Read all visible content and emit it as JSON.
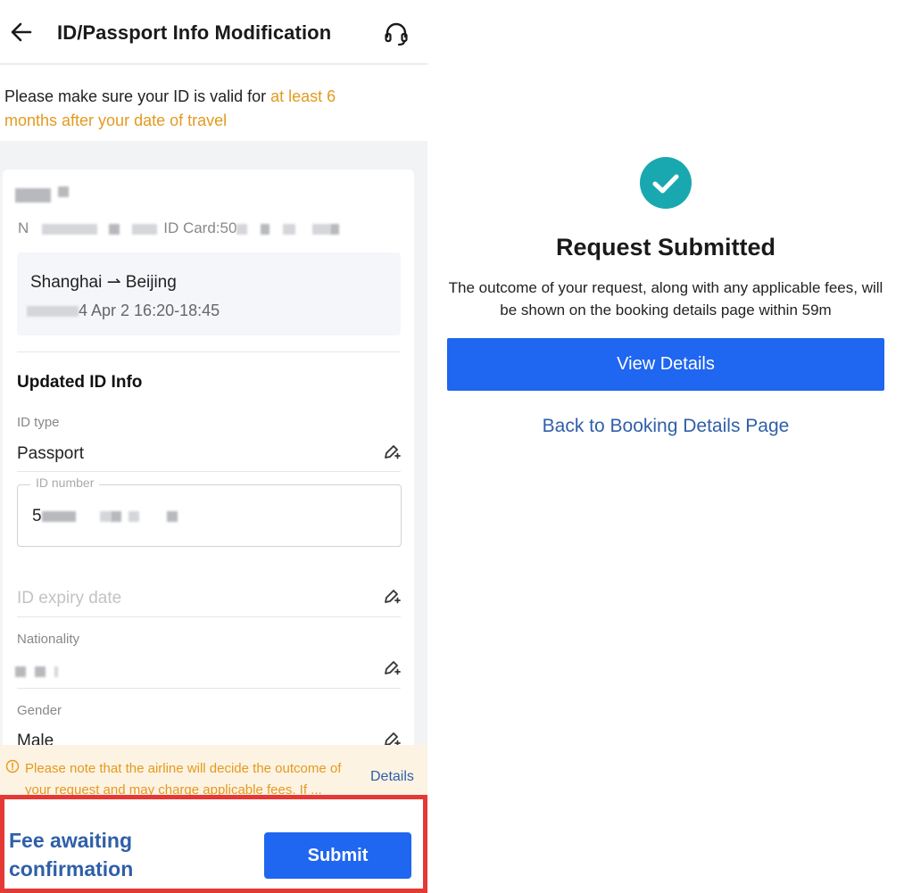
{
  "header": {
    "title": "ID/Passport Info Modification",
    "back_icon": "arrow-left-icon",
    "support_icon": "headset-icon"
  },
  "notice": {
    "prefix": "Please make sure your ID is valid for ",
    "highlight": "at least 6 months after your date of travel",
    "highlight_color": "#e39a1f"
  },
  "passenger": {
    "id_prefix": "N",
    "id_card_label": "ID Card:50"
  },
  "trip": {
    "route_from": "Shanghai",
    "route_arrow": "⇀",
    "route_to": "Beijing",
    "time_suffix": "4 Apr 2 16:20-18:45"
  },
  "updated_info": {
    "section_title": "Updated ID Info",
    "id_type_label": "ID type",
    "id_type_value": "Passport",
    "id_number_label": "ID number",
    "id_number_prefix": "5",
    "id_expiry_placeholder": "ID expiry date",
    "nationality_label": "Nationality",
    "gender_label": "Gender",
    "gender_value": "Male"
  },
  "warning": {
    "text": "Please note that the airline will decide the outcome of your request and may charge applicable fees. If ...",
    "details_label": "Details"
  },
  "bottom": {
    "fee_line1": "Fee awaiting",
    "fee_line2": "confirmation",
    "submit_label": "Submit"
  },
  "result": {
    "title": "Request Submitted",
    "description": "The outcome of your request, along with any applicable fees, will be shown on the booking details page within 59m",
    "view_details_label": "View Details",
    "back_label": "Back to Booking Details Page",
    "accent_color": "#1f66f0",
    "success_color": "#1aa8b0"
  }
}
